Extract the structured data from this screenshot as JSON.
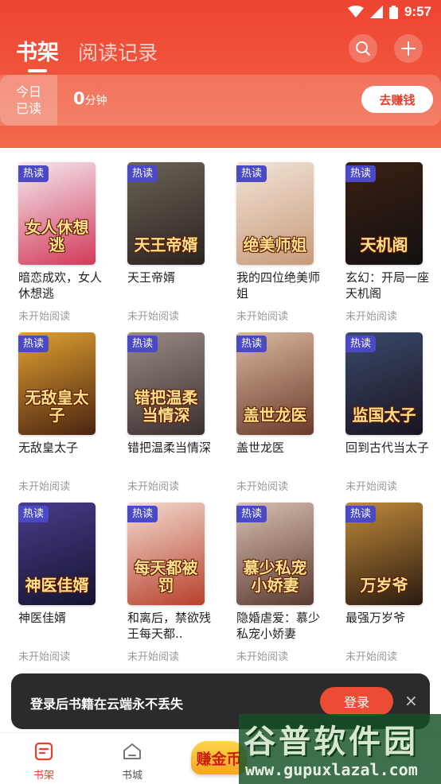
{
  "status_bar": {
    "time": "9:57"
  },
  "header": {
    "tabs": [
      {
        "label": "书架",
        "active": true
      },
      {
        "label": "阅读记录",
        "active": false
      }
    ],
    "icons": [
      "search-icon",
      "plus-icon"
    ]
  },
  "reading_card": {
    "today_line1": "今日",
    "today_line2": "已读",
    "minutes_value": "0",
    "minutes_unit": "分钟",
    "earn_label": "去赚钱"
  },
  "books": [
    {
      "cover_text": "女人休想逃",
      "title": "暗恋成欢，女人休想逃",
      "status": "未开始阅读",
      "badge": "热读",
      "colors": [
        "#f4e9ef",
        "#d23a5a"
      ]
    },
    {
      "cover_text": "天王帝婿",
      "title": "天王帝婿",
      "status": "未开始阅读",
      "badge": "热读",
      "colors": [
        "#6b6256",
        "#2a241f"
      ]
    },
    {
      "cover_text": "绝美师姐",
      "title": "我的四位绝美师姐",
      "status": "未开始阅读",
      "badge": "热读",
      "colors": [
        "#f2e3d6",
        "#c79b7a"
      ]
    },
    {
      "cover_text": "天机阁",
      "title": "玄幻：开局一座天机阁",
      "status": "未开始阅读",
      "badge": "热读",
      "colors": [
        "#3b2014",
        "#121010"
      ]
    },
    {
      "cover_text": "无敌皇太子",
      "title": "无敌皇太子",
      "status": "未开始阅读",
      "badge": "热读",
      "colors": [
        "#e0a030",
        "#4a2410"
      ]
    },
    {
      "cover_text": "错把温柔当情深",
      "title": "错把温柔当情深",
      "status": "未开始阅读",
      "badge": "热读",
      "colors": [
        "#9a8a86",
        "#3a302e"
      ]
    },
    {
      "cover_text": "盖世龙医",
      "title": "盖世龙医",
      "status": "未开始阅读",
      "badge": "热读",
      "colors": [
        "#d8b8a0",
        "#6a3a2a"
      ]
    },
    {
      "cover_text": "监国太子",
      "title": "回到古代当太子",
      "status": "未开始阅读",
      "badge": "热读",
      "colors": [
        "#3a4a6a",
        "#1a1420"
      ]
    },
    {
      "cover_text": "神医佳婿",
      "title": "神医佳婿",
      "status": "未开始阅读",
      "badge": "热读",
      "colors": [
        "#4a3c8a",
        "#141430"
      ]
    },
    {
      "cover_text": "每天都被罚",
      "title": "和离后，禁欲残王每天都..",
      "status": "未开始阅读",
      "badge": "热读",
      "colors": [
        "#f2dcd0",
        "#b8402c"
      ]
    },
    {
      "cover_text": "慕少私宠小娇妻",
      "title": "隐婚虐爱：慕少私宠小娇妻",
      "status": "未开始阅读",
      "badge": "热读",
      "colors": [
        "#d8c0b0",
        "#5a3a30"
      ]
    },
    {
      "cover_text": "万岁爷",
      "title": "最强万岁爷",
      "status": "未开始阅读",
      "badge": "热读",
      "colors": [
        "#c08a3a",
        "#2a1a10"
      ]
    }
  ],
  "toast": {
    "text": "登录后书籍在云端永不丢失",
    "button": "登录",
    "close": "×"
  },
  "bottom_nav": [
    {
      "label": "书架",
      "active": true,
      "icon": "bookshelf-icon"
    },
    {
      "label": "书城",
      "active": false,
      "icon": "store-icon"
    }
  ],
  "earn_badge": "赚金币",
  "watermark": {
    "title": "谷普软件园",
    "url": "www.gupuxlazal.com"
  }
}
